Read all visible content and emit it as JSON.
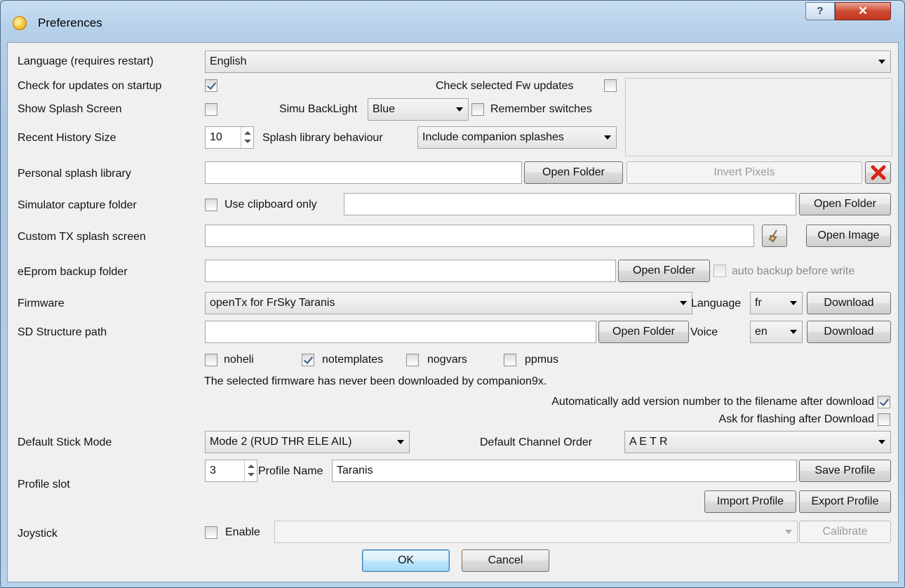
{
  "window": {
    "title": "Preferences"
  },
  "language": {
    "label": "Language (requires restart)",
    "value": "English"
  },
  "updates": {
    "check_startup_label": "Check for updates on startup",
    "check_startup_checked": true,
    "check_fw_label": "Check selected Fw updates",
    "check_fw_checked": false
  },
  "splash": {
    "show_label": "Show Splash Screen",
    "show_checked": false,
    "backlight_label": "Simu BackLight",
    "backlight_value": "Blue",
    "remember_label": "Remember switches",
    "remember_checked": false
  },
  "history": {
    "label": "Recent History Size",
    "value": "10",
    "splash_behaviour_label": "Splash library behaviour",
    "splash_behaviour_value": "Include companion splashes"
  },
  "personal_splash": {
    "label": "Personal splash library",
    "value": "",
    "open_folder": "Open Folder",
    "invert_pixels": "Invert Pixels"
  },
  "sim_capture": {
    "label": "Simulator capture folder",
    "clipboard_label": "Use clipboard only",
    "clipboard_checked": false,
    "value": "",
    "open_folder": "Open Folder"
  },
  "custom_splash": {
    "label": "Custom TX splash screen",
    "value": "",
    "open_image": "Open Image"
  },
  "eeprom": {
    "label": "eEprom backup folder",
    "value": "",
    "open_folder": "Open Folder",
    "auto_backup_label": "auto backup before write",
    "auto_backup_checked": false
  },
  "firmware": {
    "label": "Firmware",
    "value": "openTx for FrSky Taranis",
    "language_label": "Language",
    "language_value": "fr",
    "download": "Download"
  },
  "sd": {
    "label": "SD Structure path",
    "value": "",
    "open_folder": "Open Folder",
    "voice_label": "Voice",
    "voice_value": "en",
    "download": "Download"
  },
  "options": {
    "noheli": "noheli",
    "noheli_checked": false,
    "notemplates": "notemplates",
    "notemplates_checked": true,
    "nogvars": "nogvars",
    "nogvars_checked": false,
    "ppmus": "ppmus",
    "ppmus_checked": false
  },
  "fw_status": "The selected firmware has never been downloaded by companion9x.",
  "auto_version": {
    "label": "Automatically add version number to the filename after download",
    "checked": true
  },
  "ask_flash": {
    "label": "Ask for flashing after Download",
    "checked": false
  },
  "stick": {
    "label": "Default Stick Mode",
    "value": "Mode 2 (RUD THR ELE AIL)",
    "channel_label": "Default Channel Order",
    "channel_value": "A E T R"
  },
  "profile": {
    "label": "Profile slot",
    "slot": "3",
    "name_label": "Profile Name",
    "name_value": "Taranis",
    "save": "Save Profile",
    "import": "Import Profile",
    "export": "Export Profile"
  },
  "joystick": {
    "label": "Joystick",
    "enable_label": "Enable",
    "enable_checked": false,
    "calibrate": "Calibrate"
  },
  "dialog": {
    "ok": "OK",
    "cancel": "Cancel"
  },
  "colors": {
    "accent": "#3c7fb1",
    "close": "#c2381e",
    "frame": "#a9c6e2"
  }
}
